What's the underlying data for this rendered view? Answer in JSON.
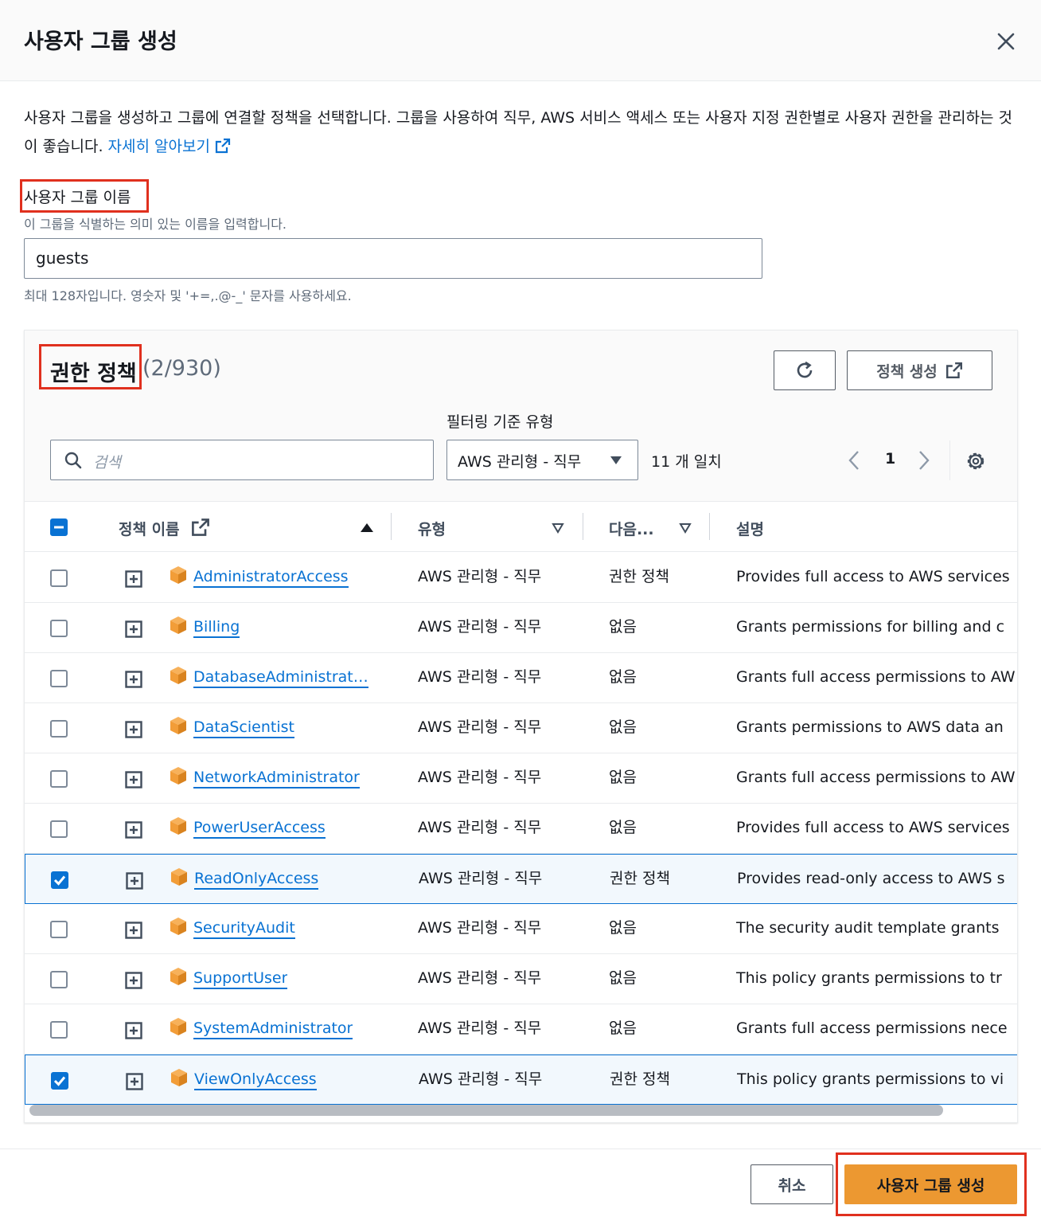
{
  "modal": {
    "title": "사용자 그룹 생성"
  },
  "intro": {
    "text": "사용자 그룹을 생성하고 그룹에 연결할 정책을 선택합니다. 그룹을 사용하여 직무, AWS 서비스 액세스 또는 사용자 지정 권한별로 사용자 권한을 관리하는 것이 좋습니다.",
    "link_label": "자세히 알아보기"
  },
  "group_name": {
    "label": "사용자 그룹 이름",
    "description": "이 그룹을 식별하는 의미 있는 이름을 입력합니다.",
    "value": "guests",
    "constraint": "최대 128자입니다. 영숫자 및 '+=,.@-_' 문자를 사용하세요."
  },
  "policies": {
    "title": "권한 정책",
    "count": "(2/930)",
    "create_policy_label": "정책 생성",
    "filter_label": "필터링 기준 유형",
    "search_placeholder": "검색",
    "filter_value": "AWS 관리형 - 직무",
    "match_count": "11 개 일치",
    "page": "1",
    "columns": {
      "name": "정책 이름",
      "type": "유형",
      "next": "다음...",
      "description": "설명"
    },
    "rows": [
      {
        "name": "AdministratorAccess",
        "type": "AWS 관리형 - 직무",
        "next": "권한 정책",
        "description": "Provides full access to AWS services",
        "selected": false
      },
      {
        "name": "Billing",
        "type": "AWS 관리형 - 직무",
        "next": "없음",
        "description": "Grants permissions for billing and c",
        "selected": false
      },
      {
        "name": "DatabaseAdministrator",
        "type": "AWS 관리형 - 직무",
        "next": "없음",
        "description": "Grants full access permissions to AW",
        "selected": false
      },
      {
        "name": "DataScientist",
        "type": "AWS 관리형 - 직무",
        "next": "없음",
        "description": "Grants permissions to AWS data an",
        "selected": false
      },
      {
        "name": "NetworkAdministrator",
        "type": "AWS 관리형 - 직무",
        "next": "없음",
        "description": "Grants full access permissions to AW",
        "selected": false
      },
      {
        "name": "PowerUserAccess",
        "type": "AWS 관리형 - 직무",
        "next": "없음",
        "description": "Provides full access to AWS services",
        "selected": false
      },
      {
        "name": "ReadOnlyAccess",
        "type": "AWS 관리형 - 직무",
        "next": "권한 정책",
        "description": "Provides read-only access to AWS s",
        "selected": true
      },
      {
        "name": "SecurityAudit",
        "type": "AWS 관리형 - 직무",
        "next": "없음",
        "description": "The security audit template grants",
        "selected": false
      },
      {
        "name": "SupportUser",
        "type": "AWS 관리형 - 직무",
        "next": "없음",
        "description": "This policy grants permissions to tr",
        "selected": false
      },
      {
        "name": "SystemAdministrator",
        "type": "AWS 관리형 - 직무",
        "next": "없음",
        "description": "Grants full access permissions nece",
        "selected": false
      },
      {
        "name": "ViewOnlyAccess",
        "type": "AWS 관리형 - 직무",
        "next": "권한 정책",
        "description": "This policy grants permissions to vi",
        "selected": true
      }
    ]
  },
  "footer": {
    "cancel_label": "취소",
    "create_label": "사용자 그룹 생성"
  },
  "colors": {
    "link": "#0972d3",
    "primary_button": "#ec9831",
    "highlight_box": "#e0301e",
    "aws_box_icon": "#f29d38"
  },
  "icons": [
    "close-icon",
    "external-link-icon",
    "refresh-icon",
    "search-icon",
    "caret-down-icon",
    "chevron-left-icon",
    "chevron-right-icon",
    "gear-icon",
    "sort-up-icon",
    "filter-caret-icon",
    "expand-icon",
    "aws-box-icon",
    "checkmark-icon"
  ]
}
